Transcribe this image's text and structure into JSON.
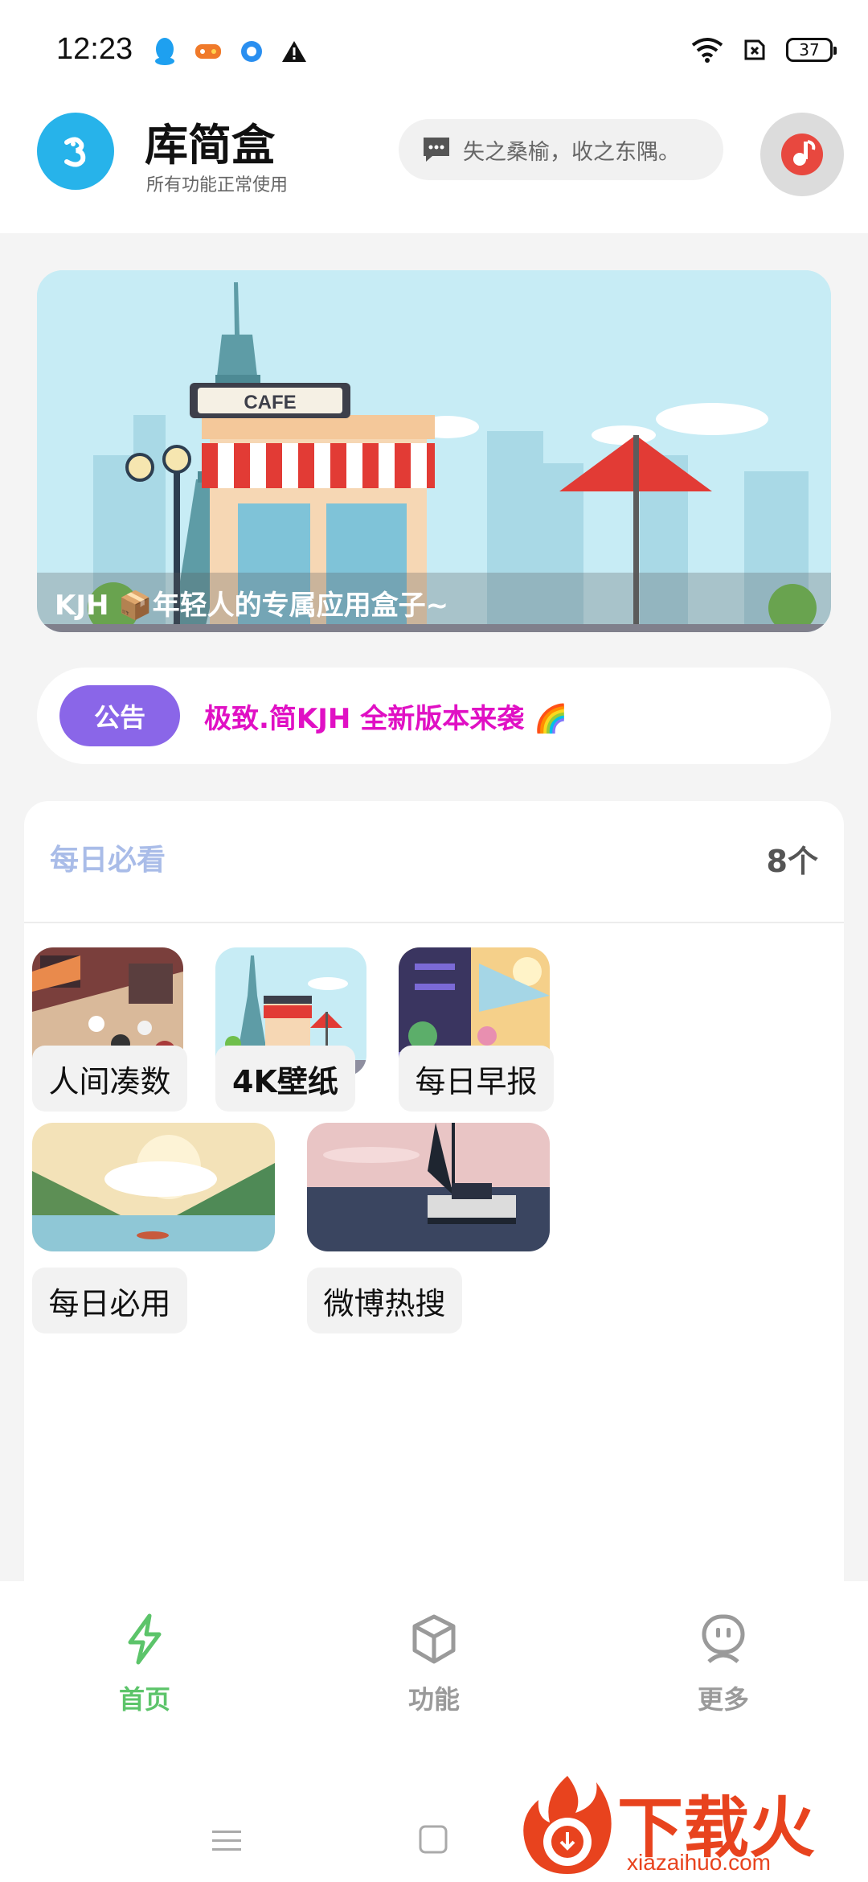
{
  "status_bar": {
    "time": "12:23",
    "battery": "37",
    "left_icons": [
      "qq-icon",
      "game-icon",
      "browser-icon",
      "warning-icon"
    ],
    "right_icons": [
      "wifi-icon",
      "sim-icon",
      "battery-icon"
    ]
  },
  "header": {
    "app_name": "库简盒",
    "subtitle": "所有功能正常使用",
    "quote": "失之桑榆，收之东隅。"
  },
  "banner": {
    "caption": "KJH 📦年轻人的专属应用盒子~",
    "cafe_sign": "CAFE"
  },
  "notice": {
    "badge": "公告",
    "text": "极致.简KJH 全新版本来袭 🌈"
  },
  "daily": {
    "title": "每日必看",
    "count": "8个",
    "items": [
      {
        "label": "人间凑数"
      },
      {
        "label": "4K壁纸"
      },
      {
        "label": "每日早报"
      },
      {
        "label": "每日必用"
      },
      {
        "label": "微博热搜"
      }
    ]
  },
  "nav": {
    "items": [
      {
        "label": "首页",
        "icon": "lightning-icon",
        "active": true
      },
      {
        "label": "功能",
        "icon": "cube-icon",
        "active": false
      },
      {
        "label": "更多",
        "icon": "robot-icon",
        "active": false
      }
    ]
  },
  "watermark": {
    "text": "下载火",
    "url": "xiazaihuo.com"
  },
  "colors": {
    "accent_green": "#5cc46a",
    "notice_purple": "#8a66e8",
    "notice_text": "#e010c4",
    "logo_blue": "#27b3ea",
    "music_red": "#e8483f",
    "watermark_orange": "#e8431e"
  }
}
